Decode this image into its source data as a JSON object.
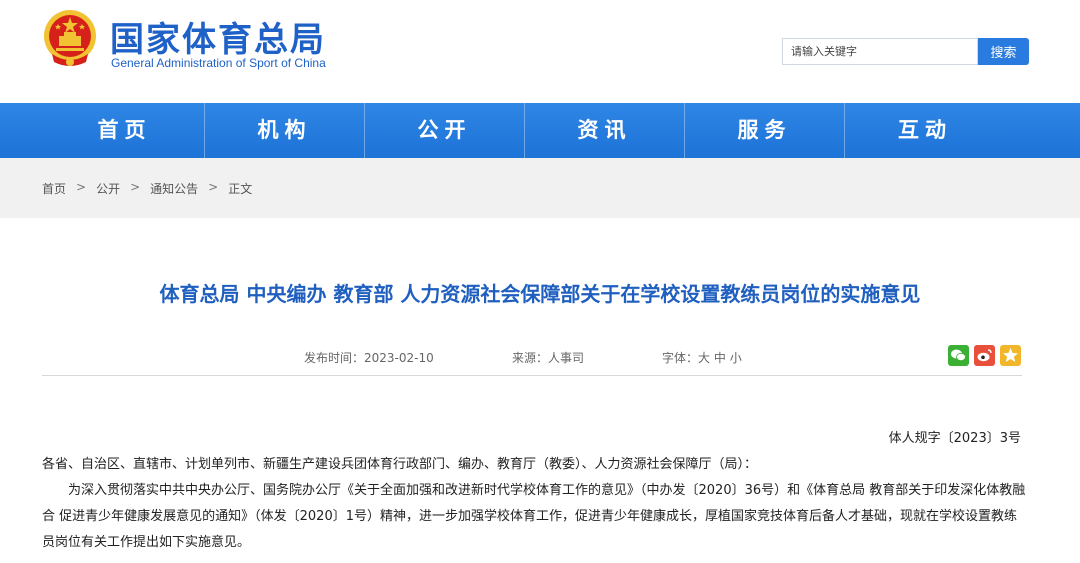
{
  "header": {
    "site_name": "国家体育总局",
    "site_name_en": "General Administration of Sport of China",
    "search_placeholder": "请输入关键字",
    "search_button": "搜索"
  },
  "nav": {
    "items": [
      {
        "label": "首页"
      },
      {
        "label": "机构"
      },
      {
        "label": "公开"
      },
      {
        "label": "资讯"
      },
      {
        "label": "服务"
      },
      {
        "label": "互动"
      }
    ]
  },
  "breadcrumb": {
    "items": [
      "首页",
      "公开",
      "通知公告",
      "正文"
    ],
    "separator": ">"
  },
  "article": {
    "title": "体育总局 中央编办 教育部 人力资源社会保障部关于在学校设置教练员岗位的实施意见",
    "publish_time": "发布时间：2023-02-10",
    "source": "来源：人事司",
    "font_size_label": "字体：",
    "font_large": "大",
    "font_medium": "中",
    "font_small": "小",
    "doc_number": "体人规字〔2023〕3号",
    "addressee": "各省、自治区、直辖市、计划单列市、新疆生产建设兵团体育行政部门、编办、教育厅（教委）、人力资源社会保障厅（局）：",
    "body": "为深入贯彻落实中共中央办公厅、国务院办公厅《关于全面加强和改进新时代学校体育工作的意见》（中办发〔2020〕36号）和《体育总局 教育部关于印发深化体教融合 促进青少年健康发展意见的通知》（体发〔2020〕1号）精神，进一步加强学校体育工作，促进青少年健康成长，厚植国家竞技体育后备人才基础，现就在学校设置教练员岗位有关工作提出如下实施意见。"
  },
  "share": {
    "icons": [
      "wechat-icon",
      "weibo-icon",
      "qzone-icon"
    ]
  },
  "colors": {
    "brand_blue": "#1f62c7",
    "nav_blue": "#2680e3",
    "title_blue": "#1f5fbf",
    "search_button": "#2a7be0",
    "emblem_red": "#d6201a",
    "emblem_gold": "#f1c232"
  }
}
